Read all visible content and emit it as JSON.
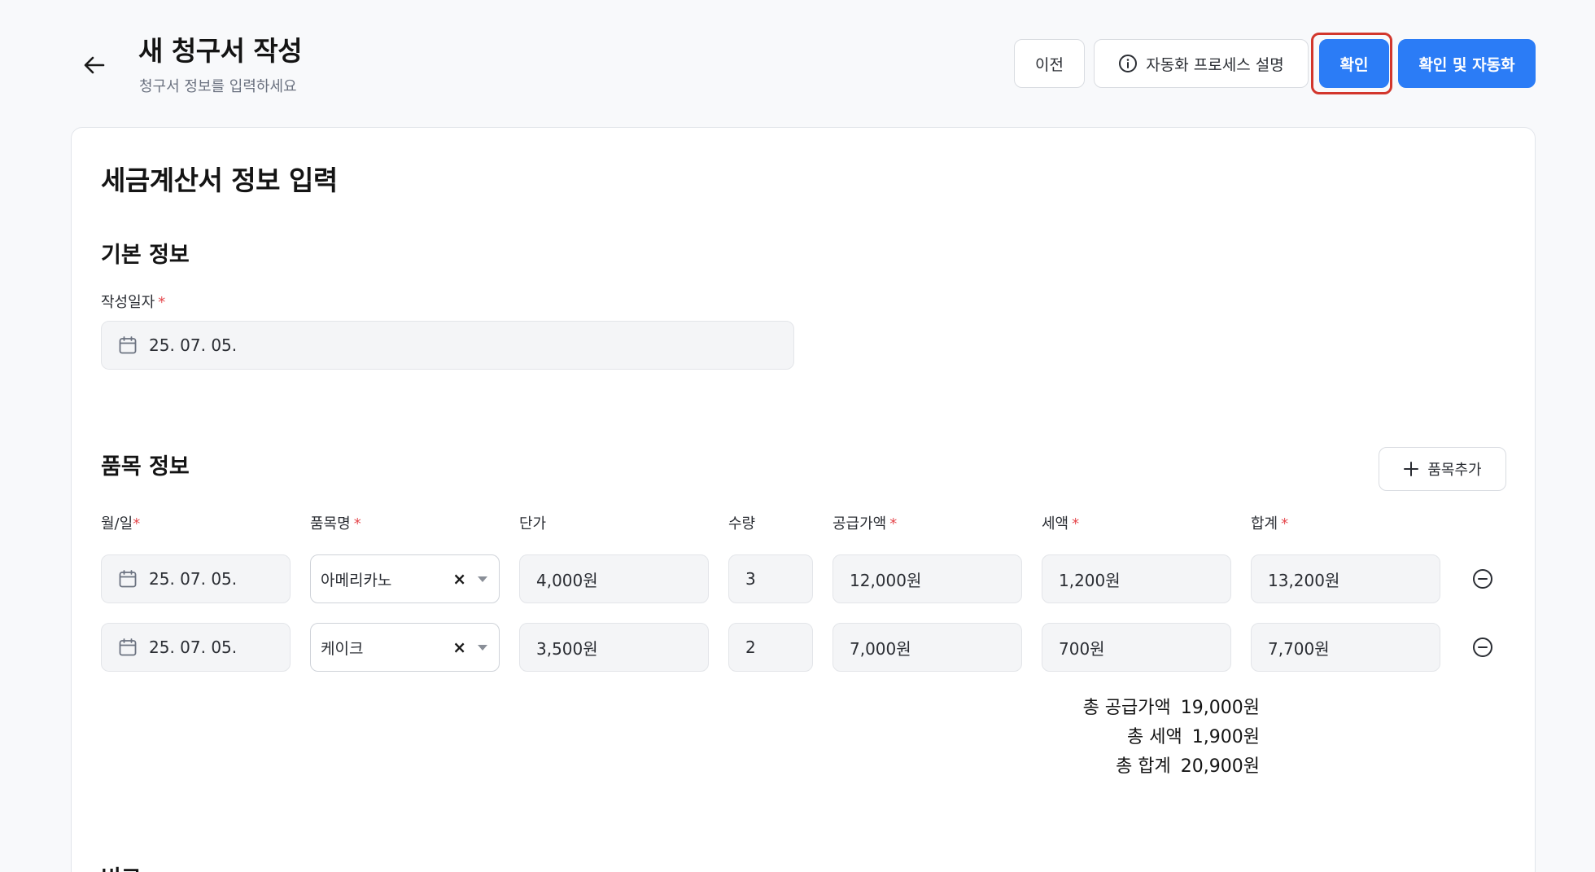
{
  "header": {
    "title": "새 청구서 작성",
    "subtitle": "청구서 정보를 입력하세요",
    "buttons": {
      "prev": "이전",
      "explain": "자동화 프로세스 설명",
      "confirm": "확인",
      "confirm_auto": "확인 및 자동화"
    }
  },
  "form": {
    "title": "세금계산서 정보 입력",
    "basic_section": {
      "title": "기본 정보",
      "date_label": "작성일자",
      "date_value": "25. 07. 05."
    },
    "items_section": {
      "title": "품목 정보",
      "add_button": "품목추가",
      "columns": {
        "date": "월/일",
        "name": "품목명",
        "unit_price": "단가",
        "qty": "수량",
        "supply": "공급가액",
        "tax": "세액",
        "total": "합계"
      },
      "rows": [
        {
          "date": "25. 07. 05.",
          "name": "아메리카노",
          "unit_price": "4,000원",
          "qty": "3",
          "supply": "12,000원",
          "tax": "1,200원",
          "total": "13,200원"
        },
        {
          "date": "25. 07. 05.",
          "name": "케이크",
          "unit_price": "3,500원",
          "qty": "2",
          "supply": "7,000원",
          "tax": "700원",
          "total": "7,700원"
        }
      ],
      "totals": {
        "supply_label": "총 공급가액",
        "supply_value": "19,000원",
        "tax_label": "총 세액",
        "tax_value": "1,900원",
        "total_label": "총 합계",
        "total_value": "20,900원"
      }
    },
    "remark_section": {
      "title": "비고"
    }
  },
  "required_mark": "*",
  "clear_glyph": "×",
  "icons": [
    "back-arrow-icon",
    "info-icon",
    "calendar-icon",
    "plus-icon",
    "minus-circle-icon",
    "chevron-down-icon"
  ],
  "colors": {
    "primary": "#2b7cf6",
    "highlight": "#d2362c",
    "required": "#e5484d"
  }
}
